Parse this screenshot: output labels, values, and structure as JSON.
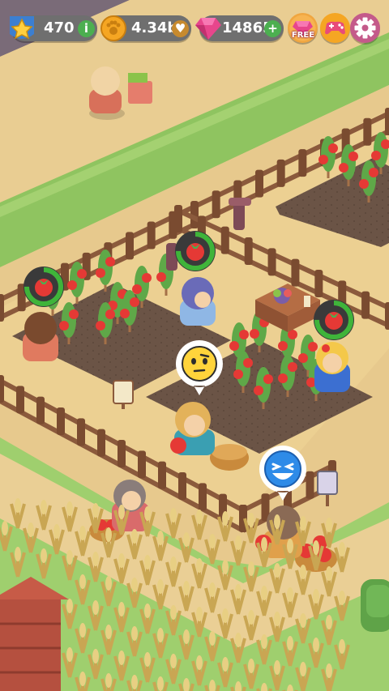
{
  "hud": {
    "level": {
      "value": "470",
      "icon": "star-badge-icon",
      "info_icon": "info-icon"
    },
    "coins": {
      "value": "4.34b",
      "icon": "paw-coin-icon",
      "action_icon": "heart-icon"
    },
    "gems": {
      "value": "14865",
      "icon": "pink-gem-icon",
      "action_icon": "plus-icon"
    },
    "free_gem_button": {
      "label": "FREE",
      "icon": "gem-gift-icon"
    },
    "game_button": {
      "icon": "gamepad-icon"
    },
    "settings_button": {
      "icon": "gear-icon"
    }
  },
  "farm": {
    "crop": "tomato",
    "progress_badges": [
      {
        "name": "tomato-progress-left",
        "progress": 0.75
      },
      {
        "name": "tomato-progress-middle",
        "progress": 0.75
      },
      {
        "name": "tomato-progress-right",
        "progress": 0.75
      }
    ],
    "emotes": [
      {
        "name": "neutral-face-emote",
        "mood": "unimpressed"
      },
      {
        "name": "laughing-face-emote",
        "mood": "happy"
      }
    ]
  },
  "colors": {
    "hud_pill": "#6f6f6f",
    "grass": "#8fc460",
    "path": "#e7c98d",
    "soil": "#6b5446",
    "fence": "#8b5a3c",
    "progress_ring": "#3fb43a"
  }
}
